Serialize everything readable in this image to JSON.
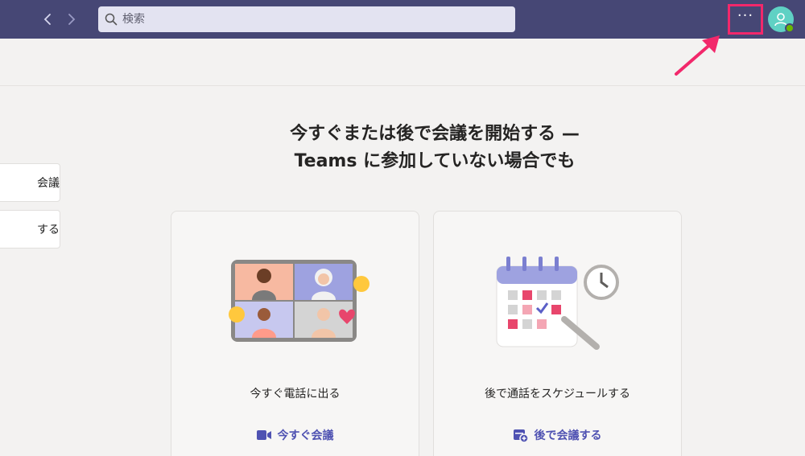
{
  "topbar": {
    "back_icon": "chevron-left-icon",
    "forward_icon": "chevron-right-icon",
    "search_placeholder": "検索",
    "more_label": "···"
  },
  "headline": {
    "line1": "今すぐまたは後で会議を開始する —",
    "line2": "Teams に参加していない場合でも"
  },
  "sidebar": {
    "items": [
      {
        "label": "会議"
      },
      {
        "label": "する"
      }
    ]
  },
  "cards": [
    {
      "title": "今すぐ電話に出る",
      "action": "今すぐ会議",
      "icon": "video-camera-icon"
    },
    {
      "title": "後で通話をスケジュールする",
      "action": "後で会議する",
      "icon": "calendar-add-icon"
    }
  ],
  "colors": {
    "topbar": "#464775",
    "accent": "#4f52b2",
    "highlight": "#f2286b",
    "avatar": "#5fd1c4"
  }
}
